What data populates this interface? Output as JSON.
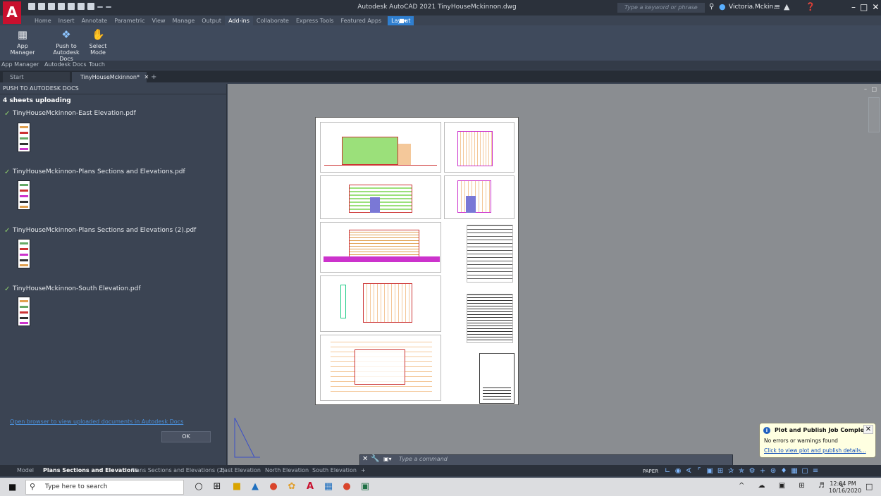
{
  "window": {
    "title": "Autodesk AutoCAD 2021   TinyHouseMckinnon.dwg",
    "search_placeholder": "Type a keyword or phrase",
    "user_name": "Victoria.Mckin..."
  },
  "ribbon": {
    "tabs": [
      "Home",
      "Insert",
      "Annotate",
      "Parametric",
      "View",
      "Manage",
      "Output",
      "Add-ins",
      "Collaborate",
      "Express Tools",
      "Featured Apps",
      "Layout"
    ],
    "active_tab": "Add-ins",
    "buttons": {
      "app_manager": "App Manager",
      "push_to_docs_line1": "Push to",
      "push_to_docs_line2": "Autodesk Docs",
      "select_mode_line1": "Select",
      "select_mode_line2": "Mode"
    },
    "panels": [
      "App Manager",
      "Autodesk Docs",
      "Touch"
    ]
  },
  "doc_tabs": {
    "start": "Start",
    "current": "TinyHouseMckinnon*"
  },
  "palette": {
    "title": "PUSH TO AUTODESK DOCS",
    "status": "4 sheets uploading",
    "files": [
      "TinyHouseMckinnon-East Elevation.pdf",
      "TinyHouseMckinnon-Plans Sections and Elevations.pdf",
      "TinyHouseMckinnon-Plans Sections and Elevations (2).pdf",
      "TinyHouseMckinnon-South Elevation.pdf"
    ],
    "browser_link": "Open browser to view uploaded documents in Autodesk Docs",
    "ok_label": "OK"
  },
  "command_line": {
    "placeholder": "Type a command"
  },
  "layout_tabs": {
    "tabs": [
      "Model",
      "Plans Sections and Elevations",
      "Plans Sections and Elevations (2)",
      "East Elevation",
      "North Elevation",
      "South Elevation"
    ],
    "active": "Plans Sections and Elevations"
  },
  "status_bar": {
    "paper_label": "PAPER"
  },
  "notification": {
    "title": "Plot and Publish Job Complete",
    "message": "No errors or warnings found",
    "link": "Click to view plot and publish details..."
  },
  "taskbar": {
    "search_placeholder": "Type here to search",
    "time": "12:04 PM",
    "date": "10/16/2020"
  }
}
